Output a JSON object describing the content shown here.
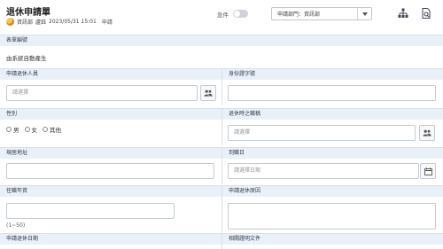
{
  "header": {
    "title": "退休申請單",
    "department": "資訊部",
    "applicant": "盧鈺",
    "datetime": "2023/05/31 15:01",
    "status": "申請",
    "urgent_label": "急件",
    "dept_select_label": "申請部門：資訊部"
  },
  "form": {
    "serial_label": "表單編號",
    "serial_value": "由系統自動產生",
    "applicant_label": "申請退休人員",
    "applicant_placeholder": "請選擇",
    "id_label": "身份證字號",
    "gender_label": "性別",
    "gender_options": [
      "男",
      "女",
      "其他"
    ],
    "position_label": "退休時之職稱",
    "position_placeholder": "請選擇",
    "address_label": "現居地址",
    "last_day_label": "到職日",
    "last_day_placeholder": "請選擇日期",
    "years_label": "任職年資",
    "years_hint": "(1~50)",
    "reason_label": "申請退休原因",
    "retire_date_label": "申請退休日期",
    "docs_label": "相關證明文件"
  }
}
